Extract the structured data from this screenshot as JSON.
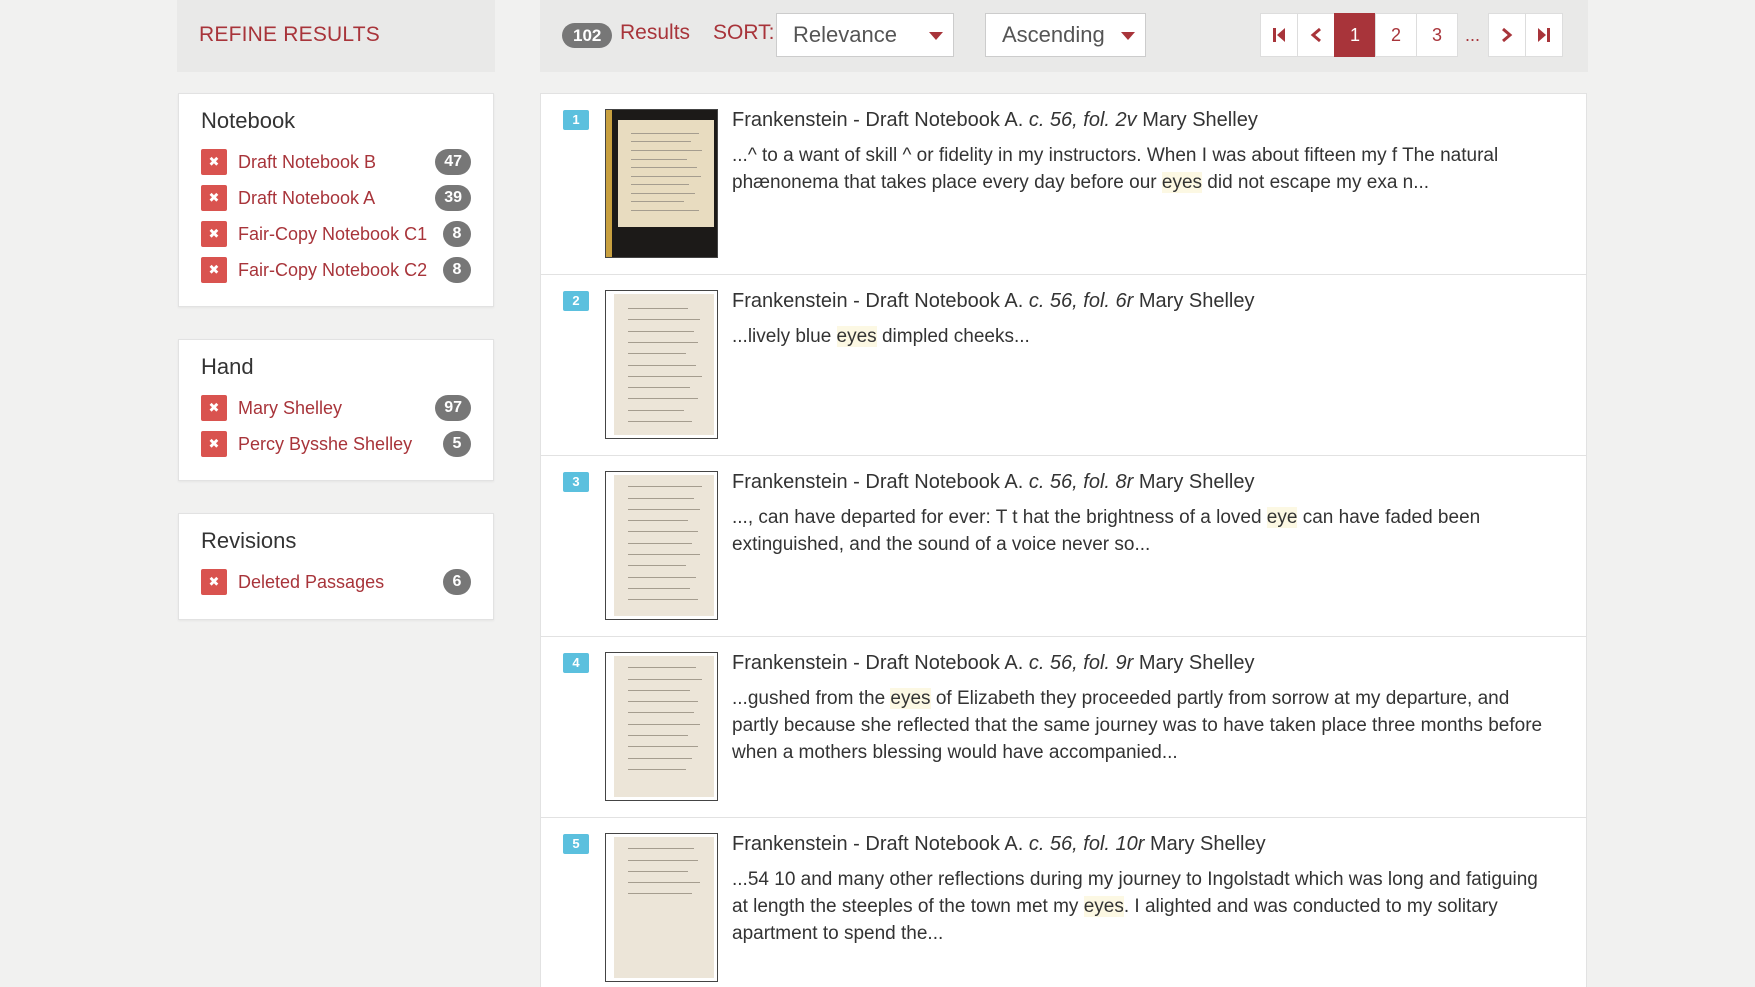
{
  "refine": {
    "title": "REFINE RESULTS"
  },
  "toolbar": {
    "count": "102",
    "results_label": "Results",
    "sort_label": "SORT:",
    "sort_value": "Relevance",
    "order_value": "Ascending",
    "pages": [
      "1",
      "2",
      "3"
    ],
    "ellipsis": "...",
    "first_icon": "first-page-icon",
    "prev_icon": "chevron-left-icon",
    "next_icon": "chevron-right-icon",
    "last_icon": "last-page-icon"
  },
  "facets": [
    {
      "title": "Notebook",
      "items": [
        {
          "label": "Draft Notebook B",
          "count": "47"
        },
        {
          "label": "Draft Notebook A",
          "count": "39"
        },
        {
          "label": "Fair-Copy Notebook C1",
          "count": "8"
        },
        {
          "label": "Fair-Copy Notebook C2",
          "count": "8"
        }
      ]
    },
    {
      "title": "Hand",
      "items": [
        {
          "label": "Mary Shelley",
          "count": "97"
        },
        {
          "label": "Percy Bysshe Shelley",
          "count": "5"
        }
      ]
    },
    {
      "title": "Revisions",
      "items": [
        {
          "label": "Deleted Passages",
          "count": "6"
        }
      ]
    }
  ],
  "results": [
    {
      "rank": "1",
      "title": "Frankenstein - Draft Notebook A.",
      "shelfmark": "c. 56, fol. 2v",
      "author": "Mary Shelley",
      "before": "...^ to a want of skill ^ or fidelity in my instructors. When I was about fifteen my f The natural phænonema that takes place every day before our ",
      "hit": "eyes",
      "after": " did not escape my exa n..."
    },
    {
      "rank": "2",
      "title": "Frankenstein - Draft Notebook A.",
      "shelfmark": "c. 56, fol. 6r",
      "author": "Mary Shelley",
      "before": "...lively blue ",
      "hit": "eyes",
      "after": " dimpled cheeks..."
    },
    {
      "rank": "3",
      "title": "Frankenstein - Draft Notebook A.",
      "shelfmark": "c. 56, fol. 8r",
      "author": "Mary Shelley",
      "before": "..., can have departed for ever: T t hat the brightness of a loved ",
      "hit": "eye",
      "after": " can have faded been extinguished, and the sound of a voice never so..."
    },
    {
      "rank": "4",
      "title": "Frankenstein - Draft Notebook A.",
      "shelfmark": "c. 56, fol. 9r",
      "author": "Mary Shelley",
      "before": "...gushed from the ",
      "hit": "eyes",
      "after": " of Elizabeth they proceeded partly from sorrow at my departure, and partly because she reflected that the same journey was to have taken place three months before when a mothers blessing would have accompanied..."
    },
    {
      "rank": "5",
      "title": "Frankenstein - Draft Notebook A.",
      "shelfmark": "c. 56, fol. 10r",
      "author": "Mary Shelley",
      "before": "...54 10 and many other reflections during my journey to Ingolstadt which was long and fatiguing at length the steeples of the town met my ",
      "hit": "eyes",
      "after": ". I alighted and was conducted to my solitary apartment to spend the..."
    }
  ]
}
